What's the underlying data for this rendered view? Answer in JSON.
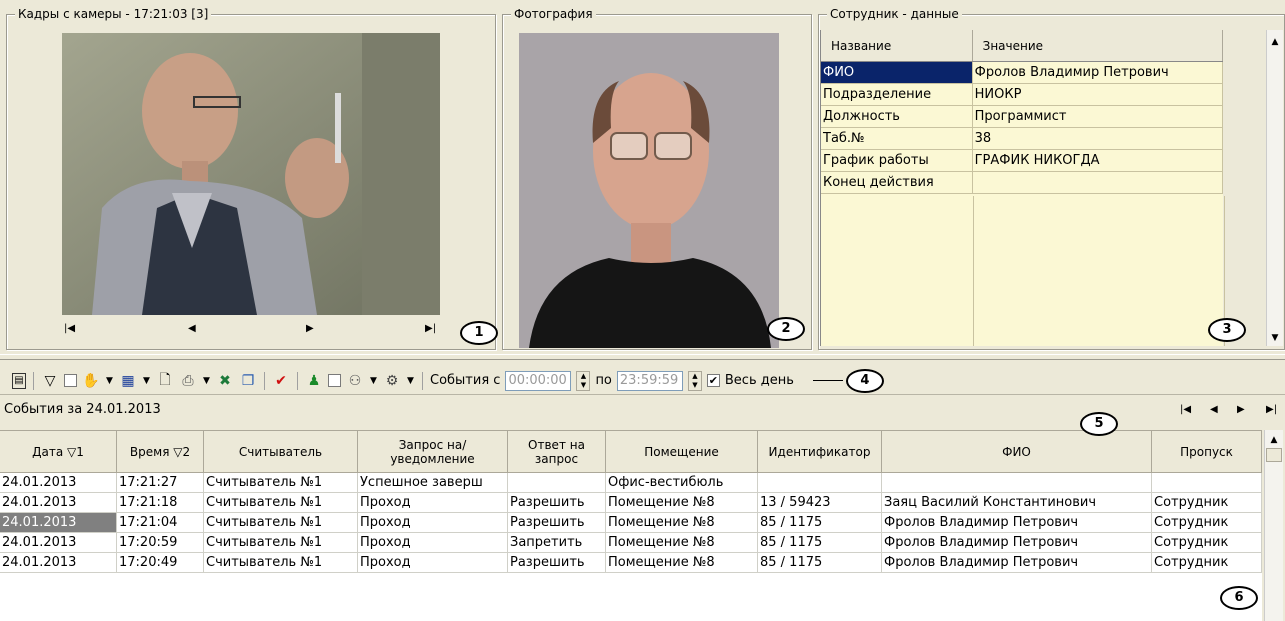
{
  "camera": {
    "legend": "Кадры с камеры  - 17:21:03 [3]",
    "nav": [
      "|◀",
      "◀",
      "▶",
      "▶|"
    ],
    "callout": "1"
  },
  "photo": {
    "legend": "Фотография",
    "callout": "2"
  },
  "employee": {
    "legend": "Сотрудник - данные",
    "columns": [
      "Название",
      "Значение"
    ],
    "rows": [
      [
        "ФИО",
        "Фролов Владимир Петрович"
      ],
      [
        "Подразделение",
        "НИОКР"
      ],
      [
        "Должность",
        "Программист"
      ],
      [
        "Таб.№",
        "38"
      ],
      [
        "График работы",
        "ГРАФИК НИКОГДА"
      ],
      [
        "Конец действия",
        ""
      ]
    ],
    "callout": "3"
  },
  "toolbar": {
    "events_from_label": "События с",
    "time_from": "00:00:00",
    "to_label": "по",
    "time_to": "23:59:59",
    "all_day_label": "Весь день",
    "all_day_checked": "✔",
    "callout": "4"
  },
  "events": {
    "title": "События за 24.01.2013",
    "nav": [
      "|◀",
      "◀",
      "▶",
      "▶|"
    ],
    "nav_callout": "5",
    "columns": [
      "Дата  ▽1",
      "Время ▽2",
      "Считыватель",
      "Запрос на/уведомление",
      "Ответ на запрос",
      "Помещение",
      "Идентификатор",
      "ФИО",
      "Пропуск"
    ],
    "rows": [
      [
        "24.01.2013",
        "17:21:27",
        "Считыватель №1",
        "Успешное заверш",
        "",
        "Офис-вестибюль",
        "",
        "",
        ""
      ],
      [
        "24.01.2013",
        "17:21:18",
        "Считыватель №1",
        "Проход",
        "Разрешить",
        "Помещение №8",
        "13 / 59423",
        "Заяц Василий Константинович",
        "Сотрудник"
      ],
      [
        "24.01.2013",
        "17:21:04",
        "Считыватель №1",
        "Проход",
        "Разрешить",
        "Помещение №8",
        "85 / 1175",
        "Фролов Владимир Петрович",
        "Сотрудник"
      ],
      [
        "24.01.2013",
        "17:20:59",
        "Считыватель №1",
        "Проход",
        "Запретить",
        "Помещение №8",
        "85 / 1175",
        "Фролов Владимир Петрович",
        "Сотрудник"
      ],
      [
        "24.01.2013",
        "17:20:49",
        "Считыватель №1",
        "Проход",
        "Разрешить",
        "Помещение №8",
        "85 / 1175",
        "Фролов Владимир Петрович",
        "Сотрудник"
      ]
    ],
    "grid_callout": "6"
  },
  "colors": {
    "selection": "#0a246a",
    "info_bg": "#fbf8d4",
    "panel_bg": "#ece9d8",
    "row_highlight": "#808080"
  }
}
